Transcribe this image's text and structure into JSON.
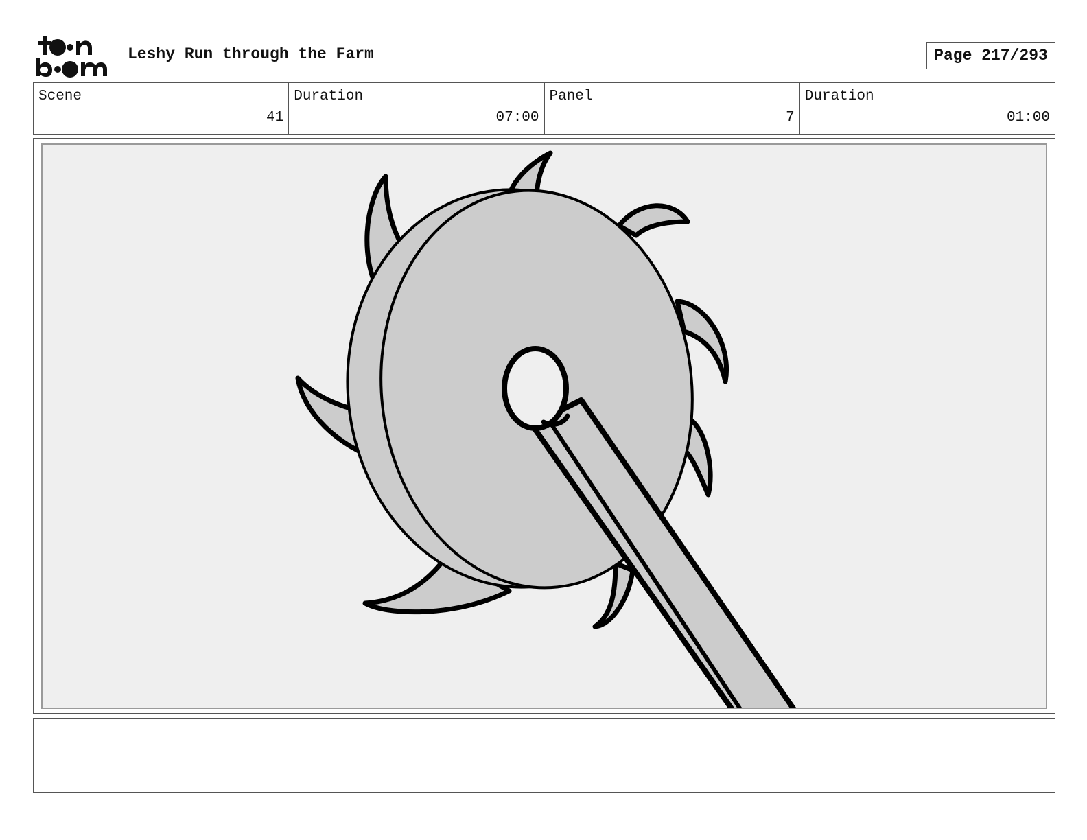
{
  "header": {
    "logo_text": "toon boom",
    "project_title": "Leshy Run through the Farm",
    "page_label": "Page 217/293"
  },
  "info": {
    "scene_label": "Scene",
    "scene_value": "41",
    "scene_duration_label": "Duration",
    "scene_duration_value": "07:00",
    "panel_label": "Panel",
    "panel_value": "7",
    "panel_duration_label": "Duration",
    "panel_duration_value": "01:00"
  },
  "panel": {
    "subject_icon": "spiked-wheel-on-stick-sketch-icon",
    "fill_color": "#cccccc",
    "background_color": "#efefef",
    "line_color": "#000000"
  },
  "notes": {
    "text": ""
  }
}
